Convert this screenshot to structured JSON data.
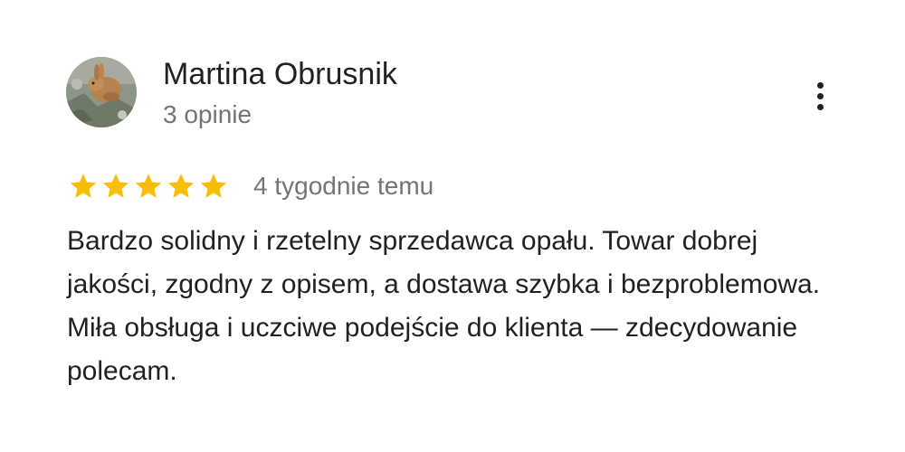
{
  "review": {
    "author_name": "Martina Obrusnik",
    "author_reviews": "3 opinie",
    "rating": 5,
    "rating_max": 5,
    "star_color": "#fbbc04",
    "date": "4 tygodnie temu",
    "text": "Bardzo solidny i rzetelny sprzedawca opału. Towar dobrej jakości, zgodny z opisem, a dostawa szybka i bezproblemowa. Miła obsługa i uczciwe podejście do klienta — zdecydowanie polecam.",
    "avatar_icon": "rabbit-photo-avatar",
    "menu_icon": "more-vert-icon"
  }
}
